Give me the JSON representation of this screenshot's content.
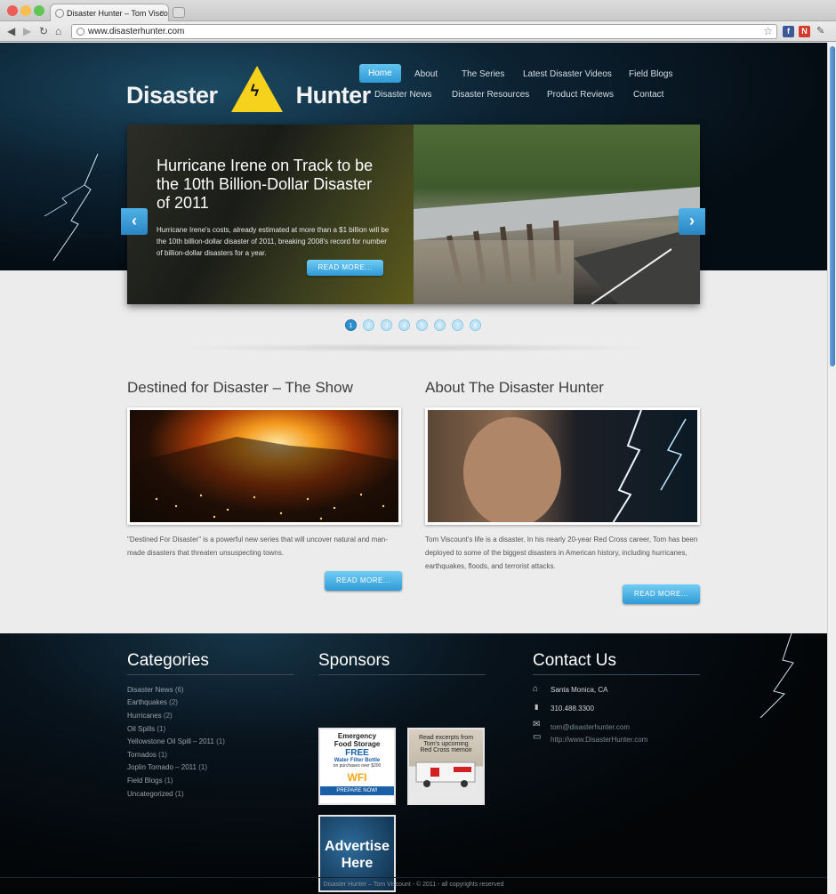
{
  "browser": {
    "tab_title": "Disaster Hunter – Tom Viscount",
    "tab_close": "×",
    "url": "www.disasterhunter.com",
    "back_glyph": "◀",
    "forward_glyph": "▶",
    "reload_glyph": "↻",
    "home_glyph": "⌂",
    "star_glyph": "☆"
  },
  "site": {
    "logo_left": "Disaster",
    "logo_right": "Hunter",
    "logo_bolt": "ϟ"
  },
  "nav": {
    "row1": [
      "Home",
      "About",
      "The Series",
      "Latest Disaster Videos",
      "Field Blogs"
    ],
    "row2": [
      "Disaster News",
      "Disaster Resources",
      "Product Reviews",
      "Contact"
    ]
  },
  "slider": {
    "title": "Hurricane Irene on Track to be the 10th Billion-Dollar Disaster of 2011",
    "text": "Hurricane Irene's costs, already estimated at more than a $1 billion will be the 10th billion-dollar disaster of 2011, breaking 2008's record for number of billion-dollar disasters for a year.",
    "button": "READ MORE...",
    "prev_glyph": "‹",
    "next_glyph": "›",
    "pages": [
      "1",
      "2",
      "3",
      "4",
      "5",
      "6",
      "7",
      "8"
    ]
  },
  "features": {
    "left": {
      "title": "Destined for Disaster – The Show",
      "text": "\"Destined For Disaster\" is a powerful new series that will uncover natural and man-made disasters that threaten unsuspecting towns.",
      "button": "READ MORE..."
    },
    "right": {
      "title": "About The Disaster Hunter",
      "text": "Tom Viscount's life is a disaster. In his nearly 20-year Red Cross career, Tom has been deployed to some of the biggest disasters in American history, including hurricanes, earthquakes, floods, and terrorist attacks.",
      "button": "READ MORE..."
    }
  },
  "footer": {
    "categories_title": "Categories",
    "categories": [
      {
        "label": "Disaster News",
        "count": "(6)"
      },
      {
        "label": "Earthquakes",
        "count": "(2)"
      },
      {
        "label": "Hurricanes",
        "count": "(2)"
      },
      {
        "label": "Oil Spills",
        "count": "(1)"
      },
      {
        "label": "Yellowstone Oil Spill – 2011",
        "count": "(1)"
      },
      {
        "label": "Tornados",
        "count": "(1)"
      },
      {
        "label": "Joplin Tornado – 2011",
        "count": "(1)"
      },
      {
        "label": "Field Blogs",
        "count": "(1)"
      },
      {
        "label": "Uncategorized",
        "count": "(1)"
      }
    ],
    "sponsors_title": "Sponsors",
    "sponsor1": {
      "line1": "Emergency",
      "line2": "Food Storage",
      "line3": "FREE",
      "line4": "Water Filter Bottle",
      "line5": "on purchases over $200",
      "brand": "WFI",
      "cta": "PREPARE NOW!"
    },
    "sponsor2": {
      "line1": "Read excerpts from",
      "line2": "Tom's upcoming",
      "line3": "Red Cross memoir"
    },
    "sponsor3": {
      "line1": "Advertise",
      "line2": "Here"
    },
    "contact_title": "Contact Us",
    "contact": {
      "location": "Santa Monica, CA",
      "phone": "310.488.3300",
      "email": "tom@disasterhunter.com",
      "web": "http://www.DisasterHunter.com"
    },
    "icons": {
      "home": "⌂",
      "phone": "▮",
      "mail": "✉",
      "web": "▭"
    },
    "copyright": "Disaster Hunter – Tom Viscount - © 2011 - all copyrights reserved"
  }
}
